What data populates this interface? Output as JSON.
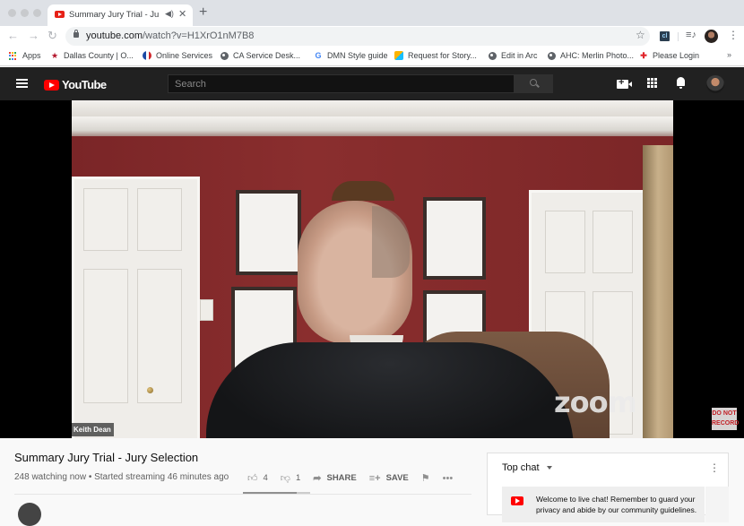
{
  "browser": {
    "tab": {
      "title": "Summary Jury Trial - Jury Selection",
      "audio_icon": "speaker-icon",
      "close_icon": "close-icon"
    },
    "new_tab_label": "+",
    "nav": {
      "back": "←",
      "forward": "→",
      "reload": "↻"
    },
    "url": {
      "host": "youtube.com",
      "path": "/watch?v=H1XrO1nM7B8"
    },
    "toolbar_icons": [
      "star-icon",
      "extension-cl-icon",
      "media-control-icon",
      "profile-avatar",
      "kebab-menu-icon"
    ],
    "extension_label": "cl",
    "bookmarks": [
      {
        "label": "Apps",
        "icon": "apps-grid-icon"
      },
      {
        "label": "Dallas County | O...",
        "icon": "star-flag-icon"
      },
      {
        "label": "Online Services",
        "icon": "texas-flag-icon"
      },
      {
        "label": "CA Service Desk...",
        "icon": "globe-icon"
      },
      {
        "label": "DMN Style guide",
        "icon": "google-icon"
      },
      {
        "label": "Request for Story...",
        "icon": "airtable-icon"
      },
      {
        "label": "Edit in Arc",
        "icon": "globe-icon"
      },
      {
        "label": "AHC: Merlin Photo...",
        "icon": "globe-icon"
      },
      {
        "label": "Please Login",
        "icon": "login-icon"
      }
    ],
    "bookmarks_overflow": "»"
  },
  "youtube": {
    "logo_text": "YouTube",
    "search": {
      "placeholder": "Search",
      "value": ""
    },
    "masthead_icons": [
      "create-video-icon",
      "apps-icon",
      "notifications-icon",
      "account-avatar"
    ]
  },
  "video": {
    "participant_name": "Keith Dean",
    "watermark": "zoom",
    "overlay_badge": [
      "DO NOT",
      "RECORD"
    ],
    "title": "Summary Jury Trial - Jury Selection",
    "meta": "248 watching now • Started streaming 46 minutes ago",
    "likes": "4",
    "dislikes": "1",
    "like_ratio": 0.8,
    "share_label": "SHARE",
    "save_label": "SAVE",
    "more_label": "•••"
  },
  "chat": {
    "header": "Top chat",
    "menu": "⋮",
    "welcome_message": "Welcome to live chat! Remember to guard your privacy and abide by our community guidelines."
  }
}
